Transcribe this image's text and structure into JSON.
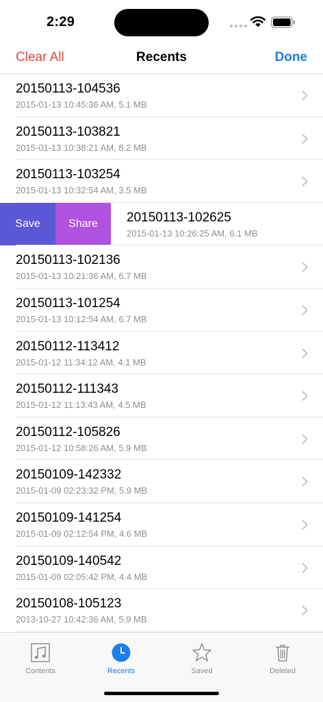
{
  "status": {
    "time": "2:29"
  },
  "nav": {
    "clear_all": "Clear All",
    "title": "Recents",
    "done": "Done"
  },
  "swipe_actions": {
    "save": "Save",
    "share": "Share"
  },
  "recordings": [
    {
      "name": "20150113-104536",
      "detail": "2015-01-13 10:45:36 AM, 5.1 MB"
    },
    {
      "name": "20150113-103821",
      "detail": "2015-01-13 10:38:21 AM, 8.2 MB"
    },
    {
      "name": "20150113-103254",
      "detail": "2015-01-13 10:32:54 AM, 3.5 MB"
    },
    {
      "name": "20150113-102625",
      "detail": "2015-01-13 10:26:25 AM, 6.1 MB"
    },
    {
      "name": "20150113-102136",
      "detail": "2015-01-13 10:21:36 AM, 6.7 MB"
    },
    {
      "name": "20150113-101254",
      "detail": "2015-01-13 10:12:54 AM, 6.7 MB"
    },
    {
      "name": "20150112-113412",
      "detail": "2015-01-12 11:34:12 AM, 4.1 MB"
    },
    {
      "name": "20150112-111343",
      "detail": "2015-01-12 11:13:43 AM, 4.5 MB"
    },
    {
      "name": "20150112-105826",
      "detail": "2015-01-12 10:58:26 AM, 5.9 MB"
    },
    {
      "name": "20150109-142332",
      "detail": "2015-01-09 02:23:32 PM, 5.9 MB"
    },
    {
      "name": "20150109-141254",
      "detail": "2015-01-09 02:12:54 PM, 4.6 MB"
    },
    {
      "name": "20150109-140542",
      "detail": "2015-01-09 02:05:42 PM, 4.4 MB"
    },
    {
      "name": "20150108-105123",
      "detail": "2013-10-27 10:42:36 AM, 5.9 MB"
    }
  ],
  "tabs": [
    {
      "label": "Contents",
      "icon": "music-note-icon"
    },
    {
      "label": "Recents",
      "icon": "clock-icon",
      "active": true
    },
    {
      "label": "Saved",
      "icon": "star-icon"
    },
    {
      "label": "Deleted",
      "icon": "trash-icon"
    }
  ],
  "colors": {
    "accent": "#1c7cf0",
    "destructive": "#e0463a",
    "save_action": "#5b58d6",
    "share_action": "#b151e0"
  }
}
